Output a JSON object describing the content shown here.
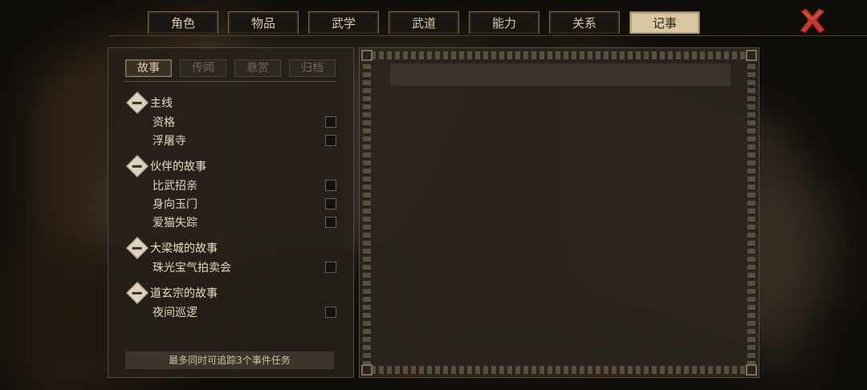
{
  "tabs": [
    "角色",
    "物品",
    "武学",
    "武道",
    "能力",
    "关系",
    "记事"
  ],
  "active_tab": "记事",
  "subtabs": [
    "故事",
    "传闻",
    "悬赏",
    "归档"
  ],
  "active_subtab": "故事",
  "groups": [
    {
      "title": "主线",
      "items": [
        "资格",
        "浮屠寺"
      ]
    },
    {
      "title": "伙伴的故事",
      "items": [
        "比武招亲",
        "身向玉门",
        "爱猫失踪"
      ]
    },
    {
      "title": "大梁城的故事",
      "items": [
        "珠光宝气拍卖会"
      ]
    },
    {
      "title": "道玄宗的故事",
      "items": [
        "夜间巡逻"
      ]
    }
  ],
  "footer_text": "最多同时可追踪3个事件任务",
  "colors": {
    "accent": "#d8c6a0",
    "close": "#c0392b"
  }
}
